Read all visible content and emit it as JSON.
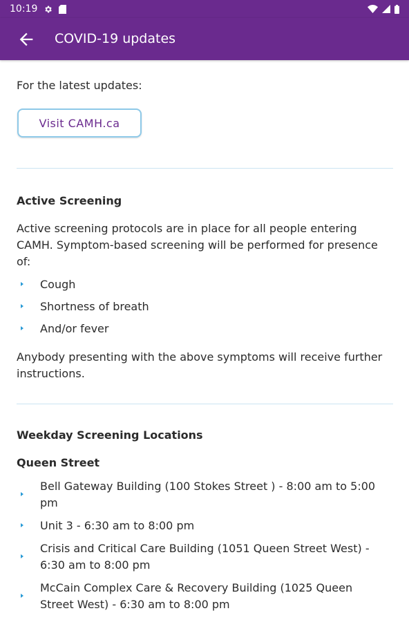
{
  "status_bar": {
    "time": "10:19"
  },
  "app_bar": {
    "title": "COVID-19 updates"
  },
  "intro": {
    "text": "For the latest updates:",
    "button_label": "Visit CAMH.ca"
  },
  "active_screening": {
    "heading": "Active Screening",
    "paragraph": "Active screening protocols are in place for all people entering CAMH. Symptom-based screening will be performed for presence of:",
    "symptoms": [
      "Cough",
      "Shortness of breath",
      "And/or fever"
    ],
    "footer": "Anybody presenting with the above symptoms will receive further instructions."
  },
  "weekday_locations": {
    "heading": "Weekday Screening Locations",
    "subheading": "Queen Street",
    "items": [
      "Bell Gateway Building (100 Stokes Street ) - 8:00 am to 5:00 pm",
      "Unit 3 - 6:30 am to 8:00 pm",
      "Crisis and Critical Care Building (1051 Queen Street West) - 6:30 am to 8:00 pm",
      "McCain Complex Care & Recovery Building (1025 Queen Street West) - 6:30 am to 8:00 pm"
    ]
  },
  "icons": {
    "back": "arrow-left-icon",
    "gear": "gear-icon",
    "sd_card": "sd-card-icon",
    "wifi": "wifi-icon",
    "signal": "cell-signal-icon",
    "battery": "battery-icon",
    "bullet": "chevron-right-bullet-icon"
  },
  "colors": {
    "primary": "#6a2a8e",
    "button_border": "#8ec9e8",
    "bullet": "#2a9bd6",
    "divider": "#cbe4f2"
  }
}
